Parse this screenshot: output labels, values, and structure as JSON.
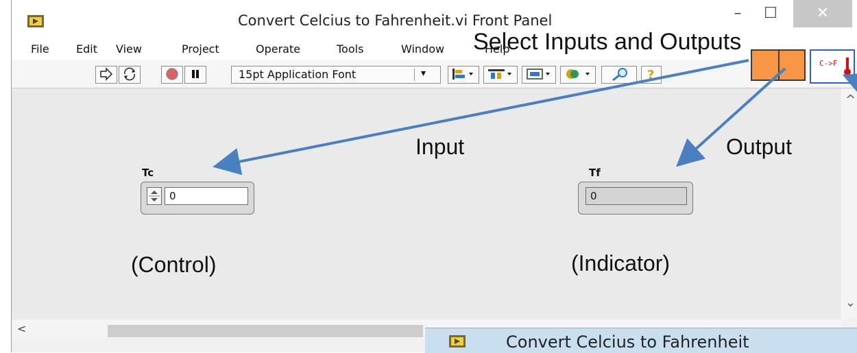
{
  "window": {
    "title": "Convert Celcius to Fahrenheit.vi Front Panel",
    "minimize": "–",
    "maximize": "☐",
    "close": "✕"
  },
  "menu": {
    "items": [
      "File",
      "Edit",
      "View",
      "Project",
      "Operate",
      "Tools",
      "Window",
      "Help"
    ]
  },
  "toolbar": {
    "font": "15pt Application Font",
    "font_arrow": "▾"
  },
  "connector_pane": {
    "color": "#f79646"
  },
  "vi_icon": {
    "text": "C->F"
  },
  "controls": {
    "input": {
      "label": "Tc",
      "value": "0"
    },
    "output": {
      "label": "Tf",
      "value": "0"
    }
  },
  "annotations": {
    "title": "Select Inputs and Outputs",
    "input": "Input",
    "output": "Output",
    "control": "(Control)",
    "indicator": "(Indicator)"
  },
  "scroll": {
    "up": "^",
    "down": "⌄",
    "left": "<"
  },
  "background_window": {
    "title": "Convert Celcius to Fahrenheit"
  },
  "colors": {
    "arrow": "#4a7fc0",
    "accent": "#f79646"
  }
}
